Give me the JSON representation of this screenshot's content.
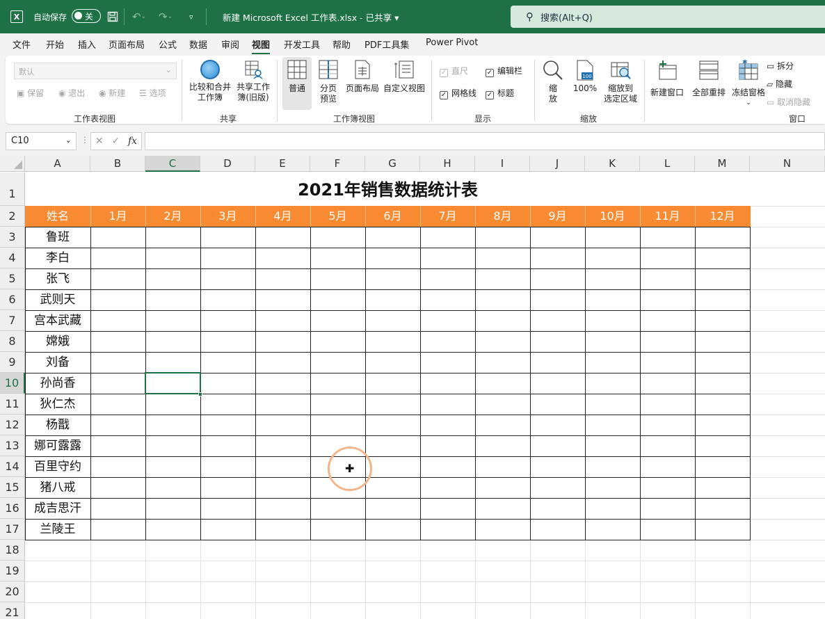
{
  "titlebar": {
    "autosave_label": "自动保存",
    "toggle_state": "关",
    "doc_title": "新建 Microsoft Excel 工作表.xlsx  -  已共享 ▾",
    "search_placeholder": "搜索(Alt+Q)",
    "bg_color": "#1e7145"
  },
  "menu": {
    "tabs": [
      "文件",
      "开始",
      "插入",
      "页面布局",
      "公式",
      "数据",
      "审阅",
      "视图",
      "开发工具",
      "帮助",
      "PDF工具集",
      "Power Pivot"
    ],
    "active": "视图"
  },
  "ribbon": {
    "sheet_view": {
      "select_value": "默认",
      "keep": "保留",
      "exit": "退出",
      "new": "新建",
      "options": "选项",
      "label": "工作表视图"
    },
    "share": {
      "compare_merge": [
        "比较和合并",
        "工作簿"
      ],
      "share_workbook": [
        "共享工作",
        "簿(旧版)"
      ],
      "label": "共享"
    },
    "workbook_views": {
      "normal": "普通",
      "page_break": [
        "分页",
        "预览"
      ],
      "page_layout": "页面布局",
      "custom_view": "自定义视图",
      "label": "工作簿视图"
    },
    "show": {
      "ruler": "直尺",
      "formula_bar": "编辑栏",
      "gridlines": "网格线",
      "headings": "标题",
      "label": "显示"
    },
    "zoom": {
      "zoom": [
        "缩",
        "放"
      ],
      "hundred": "100%",
      "zoom_selection": [
        "缩放到",
        "选定区域"
      ],
      "label": "缩放"
    },
    "window": {
      "new_window": "新建窗口",
      "arrange_all": "全部重排",
      "freeze_panes": "冻结窗格",
      "split": "拆分",
      "hide": "隐藏",
      "unhide": "取消隐藏",
      "label": "窗口"
    }
  },
  "formula_bar": {
    "name_box": "C10",
    "formula": ""
  },
  "sheet": {
    "columns": [
      "A",
      "B",
      "C",
      "D",
      "E",
      "F",
      "G",
      "H",
      "I",
      "J",
      "K",
      "L",
      "M",
      "N"
    ],
    "rows": [
      "1",
      "2",
      "3",
      "4",
      "5",
      "6",
      "7",
      "8",
      "9",
      "10",
      "11",
      "12",
      "13",
      "14",
      "15",
      "16",
      "17",
      "18",
      "19",
      "20",
      "21"
    ],
    "selected_column": "C",
    "selected_row": "10",
    "title": "2021年销售数据统计表",
    "header": [
      "姓名",
      "1月",
      "2月",
      "3月",
      "4月",
      "5月",
      "6月",
      "7月",
      "8月",
      "9月",
      "10月",
      "11月",
      "12月"
    ],
    "names": [
      "鲁班",
      "李白",
      "张飞",
      "武则天",
      "宫本武藏",
      "嫦娥",
      "刘备",
      "孙尚香",
      "狄仁杰",
      "杨戬",
      "娜可露露",
      "百里守约",
      "猪八戒",
      "成吉思汗",
      "兰陵王"
    ],
    "header_color": "#f88a31"
  }
}
